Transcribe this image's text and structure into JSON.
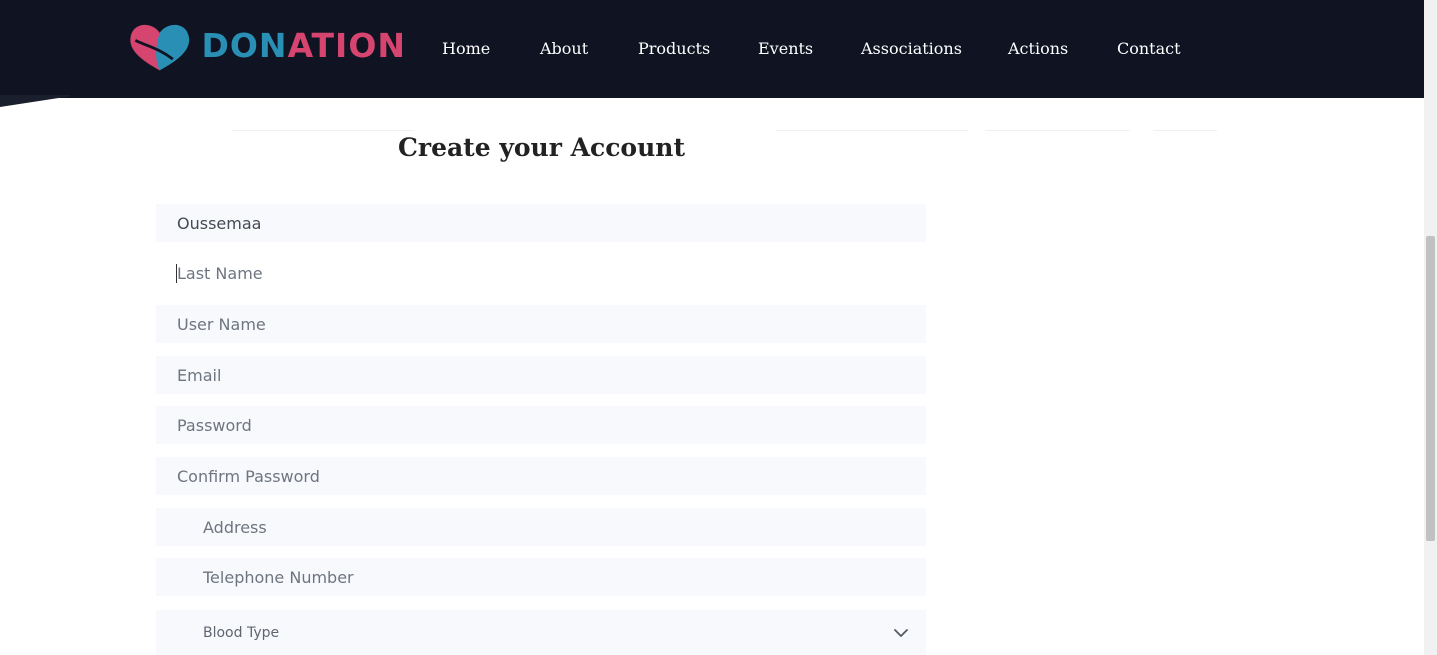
{
  "brand": {
    "name_part1": "DON",
    "name_part2": "ATION",
    "primary_color": "#2a8fb5",
    "accent_color": "#d6456f",
    "logo_icon": "heart-icon"
  },
  "nav": {
    "items": [
      {
        "label": "Home"
      },
      {
        "label": "About"
      },
      {
        "label": "Products"
      },
      {
        "label": "Events"
      },
      {
        "label": "Associations"
      },
      {
        "label": "Actions"
      },
      {
        "label": "Contact"
      }
    ]
  },
  "form": {
    "title": "Create your Account",
    "first_name": {
      "value": "Oussemaa",
      "placeholder": ""
    },
    "last_name": {
      "value": "",
      "placeholder": "Last Name"
    },
    "user_name": {
      "value": "",
      "placeholder": "User Name"
    },
    "email": {
      "value": "",
      "placeholder": "Email"
    },
    "password": {
      "value": "",
      "placeholder": "Password"
    },
    "confirm_password": {
      "value": "",
      "placeholder": "Confirm Password"
    },
    "address": {
      "value": "",
      "placeholder": "Address"
    },
    "telephone": {
      "value": "",
      "placeholder": "Telephone Number"
    },
    "blood_type": {
      "selected": "Blood Type",
      "icon": "chevron-down-icon"
    }
  }
}
